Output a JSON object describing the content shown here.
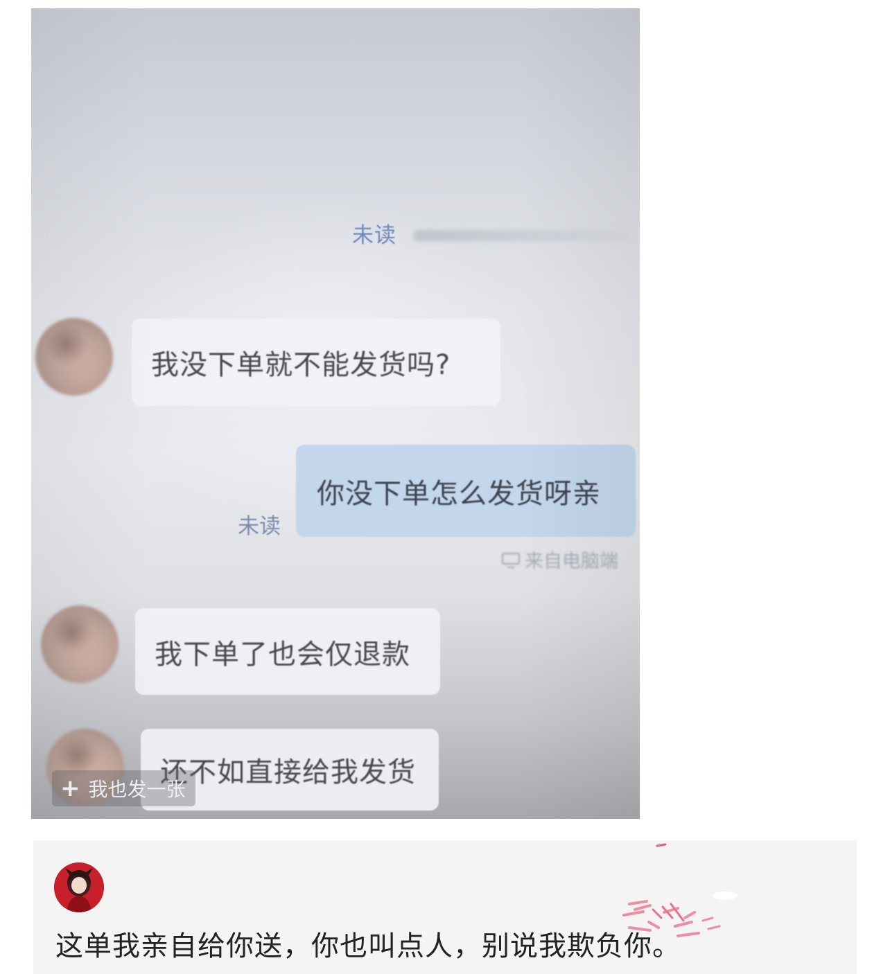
{
  "chat_screenshot": {
    "unread_top": "未读",
    "messages": [
      {
        "side": "incoming",
        "text": "我没下单就不能发货吗?"
      },
      {
        "side": "outgoing",
        "text": "你没下单怎么发货呀亲",
        "status": "未读",
        "source": "来自电脑端"
      },
      {
        "side": "incoming",
        "text": "我下单了也会仅退款"
      },
      {
        "side": "incoming",
        "text": "还不如直接给我发货"
      }
    ],
    "post_too_label": "我也发一张",
    "icons": {
      "post_too": "plus-icon",
      "source": "monitor-icon"
    }
  },
  "comment": {
    "text": "这单我亲自给你送，你也叫点人，别说我欺负你。",
    "avatar_color": "#c8202a"
  },
  "colors": {
    "outgoing_bubble": "#c3d6ea",
    "incoming_bubble": "#f1f2f5",
    "unread_text": "#6f88b8",
    "comment_background": "#f4f4f4"
  }
}
